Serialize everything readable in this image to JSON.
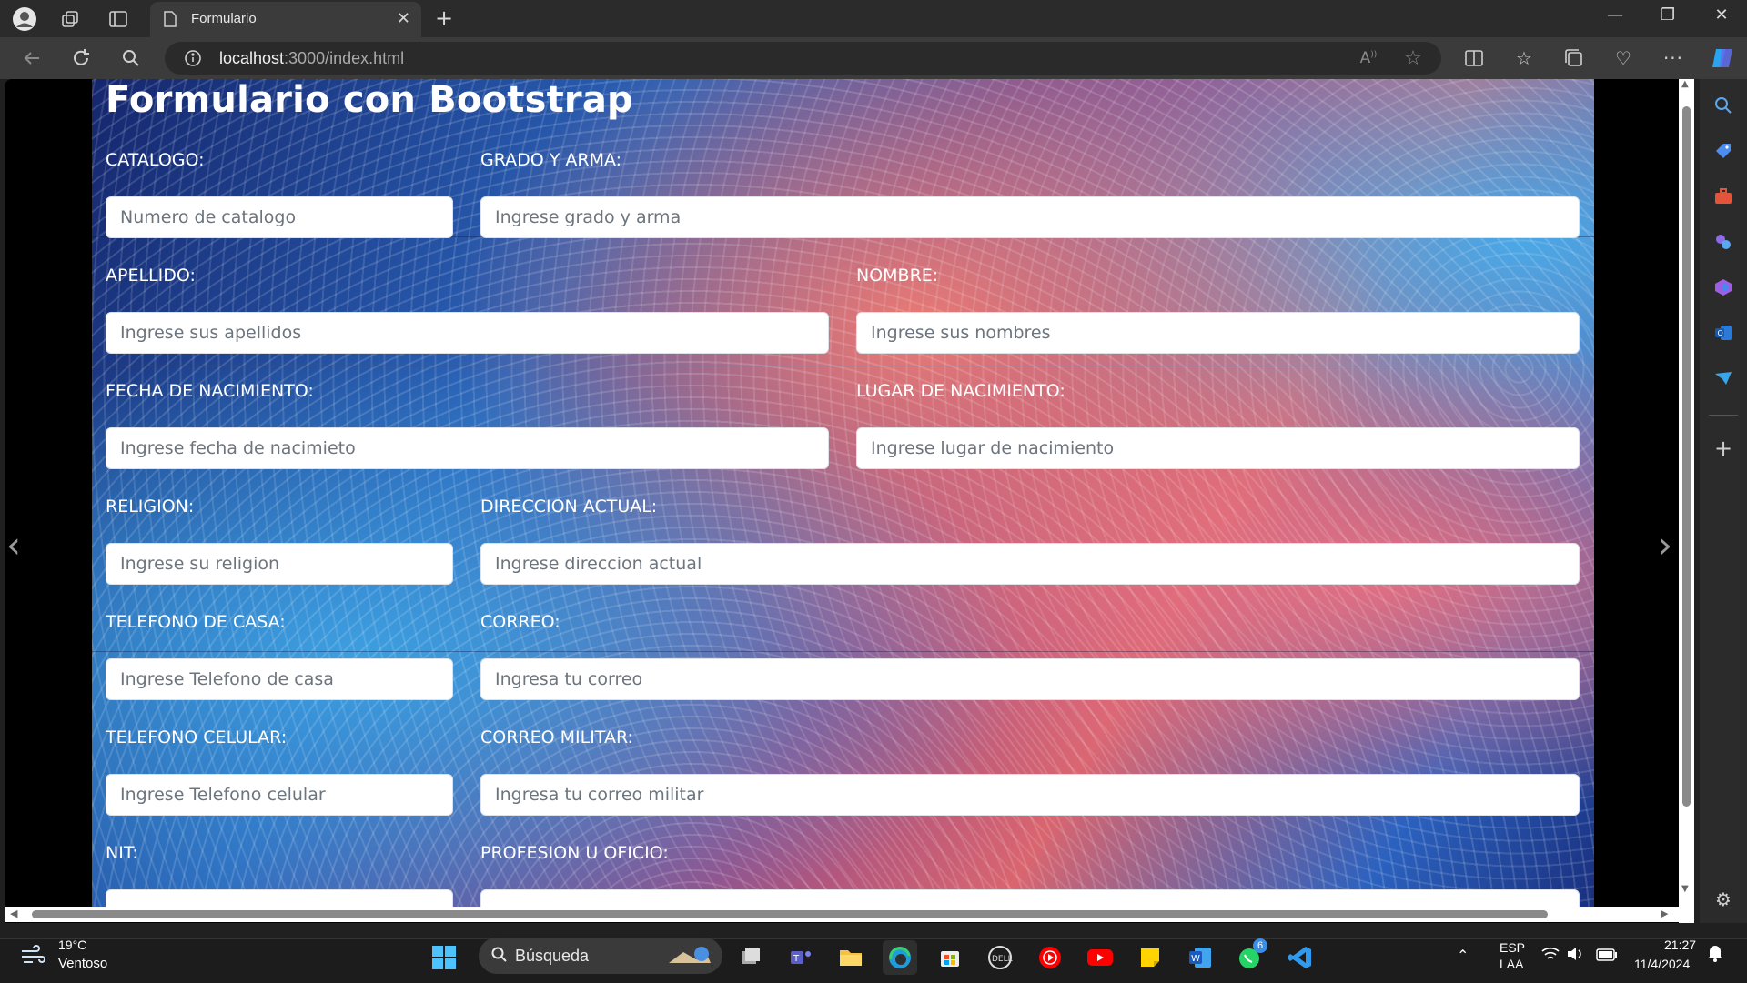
{
  "browser": {
    "tab_title": "Formulario",
    "url_host": "localhost",
    "url_rest": ":3000/index.html"
  },
  "form": {
    "heading": "Formulario con Bootstrap",
    "fields": [
      {
        "label": "CATALOGO:",
        "placeholder": "Numero de catalogo"
      },
      {
        "label": "GRADO Y ARMA:",
        "placeholder": "Ingrese grado y arma"
      },
      {
        "label": "APELLIDO:",
        "placeholder": "Ingrese sus apellidos"
      },
      {
        "label": "NOMBRE:",
        "placeholder": "Ingrese sus nombres"
      },
      {
        "label": "FECHA DE NACIMIENTO:",
        "placeholder": "Ingrese fecha de nacimieto"
      },
      {
        "label": "LUGAR DE NACIMIENTO:",
        "placeholder": "Ingrese lugar de nacimiento"
      },
      {
        "label": "RELIGION:",
        "placeholder": "Ingrese su religion"
      },
      {
        "label": "DIRECCION ACTUAL:",
        "placeholder": "Ingrese direccion actual"
      },
      {
        "label": "TELEFONO DE CASA:",
        "placeholder": "Ingrese Telefono de casa"
      },
      {
        "label": "CORREO:",
        "placeholder": "Ingresa tu correo"
      },
      {
        "label": "TELEFONO CELULAR:",
        "placeholder": "Ingrese Telefono celular"
      },
      {
        "label": "CORREO MILITAR:",
        "placeholder": "Ingresa tu correo militar"
      },
      {
        "label": "NIT:",
        "placeholder": ""
      },
      {
        "label": "PROFESION U OFICIO:",
        "placeholder": ""
      }
    ]
  },
  "taskbar": {
    "weather_temp": "19°C",
    "weather_desc": "Ventoso",
    "search_placeholder": "Búsqueda",
    "lang_top": "ESP",
    "lang_bottom": "LAA",
    "time": "21:27",
    "date": "11/4/2024",
    "whatsapp_badge": "6"
  },
  "colors": {
    "chrome_dark": "#2b2b2b",
    "chrome_mid": "#3b3b3b",
    "page_blue": "#2a62b8",
    "page_coral": "#e97a74"
  }
}
